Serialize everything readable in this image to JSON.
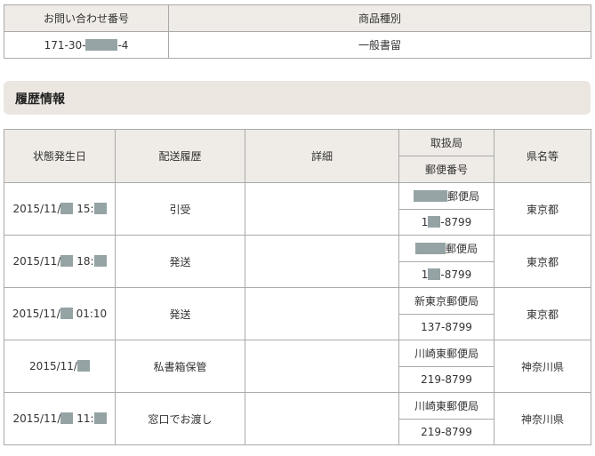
{
  "inquiry": {
    "headers": [
      "お問い合わせ番号",
      "商品種別"
    ],
    "number_prefix": "171-30-",
    "number_suffix": "-4",
    "product_type": "一般書留"
  },
  "section_title": "履歴情報",
  "history": {
    "headers": {
      "date": "状態発生日",
      "delivery_history": "配送履歴",
      "details": "詳細",
      "office": "取扱局",
      "postal_code": "郵便番号",
      "prefecture": "県名等"
    },
    "rows": [
      {
        "date_prefix": "2015/11/",
        "time_prefix": " 15:",
        "time_suffix": "",
        "status": "引受",
        "detail": "",
        "office": "郵便局",
        "postal_prefix": "1",
        "postal_suffix": "-8799",
        "prefecture": "東京都"
      },
      {
        "date_prefix": "2015/11/",
        "time_prefix": " 18:",
        "time_suffix": "",
        "status": "発送",
        "detail": "",
        "office": "郵便局",
        "postal_prefix": "1",
        "postal_suffix": "-8799",
        "prefecture": "東京都"
      },
      {
        "date_prefix": "2015/11/",
        "time_prefix": "",
        "time_suffix": " 01:10",
        "status": "発送",
        "detail": "",
        "office": "新東京郵便局",
        "postal_prefix": "137-8799",
        "postal_suffix": "",
        "prefecture": "東京都"
      },
      {
        "date_prefix": "2015/11/",
        "time_prefix": "",
        "time_suffix": "",
        "status": "私書箱保管",
        "detail": "",
        "office": "川崎東郵便局",
        "postal_prefix": "219-8799",
        "postal_suffix": "",
        "prefecture": "神奈川県"
      },
      {
        "date_prefix": "2015/11/",
        "time_prefix": " 11:",
        "time_suffix": "",
        "status": "窓口でお渡し",
        "detail": "",
        "office": "川崎東郵便局",
        "postal_prefix": "219-8799",
        "postal_suffix": "",
        "prefecture": "神奈川県"
      }
    ]
  }
}
